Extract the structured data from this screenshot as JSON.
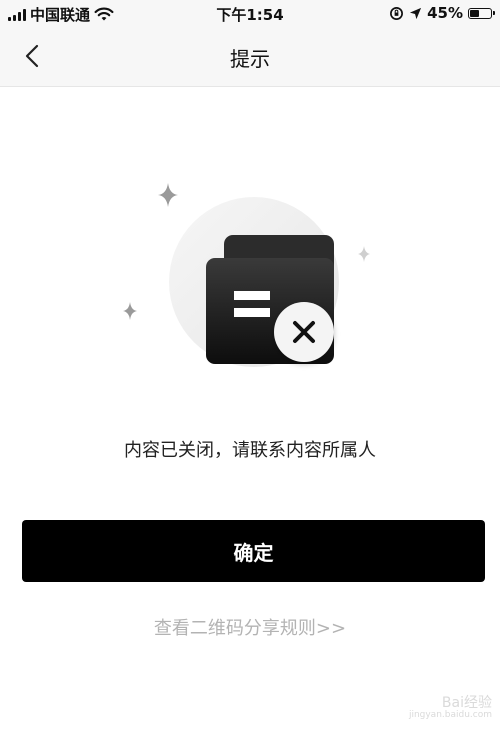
{
  "status_bar": {
    "carrier": "中国联通",
    "time": "下午1:54",
    "battery": "45%",
    "battery_level": 0.45
  },
  "nav": {
    "title": "提示"
  },
  "main": {
    "message": "内容已关闭，请联系内容所属人",
    "confirm_label": "确定",
    "rules_link": "查看二维码分享规则>>"
  },
  "watermark": {
    "text": "Bai经验",
    "sub": "jingyan.baidu.com"
  },
  "icons": [
    "wifi-icon",
    "back-chevron-icon",
    "document-closed-icon",
    "close-badge-icon",
    "sparkle-icon"
  ],
  "colors": {
    "primary_button": "#000000",
    "link": "#b3b3b3",
    "navbar_bg": "#f7f7f7"
  }
}
